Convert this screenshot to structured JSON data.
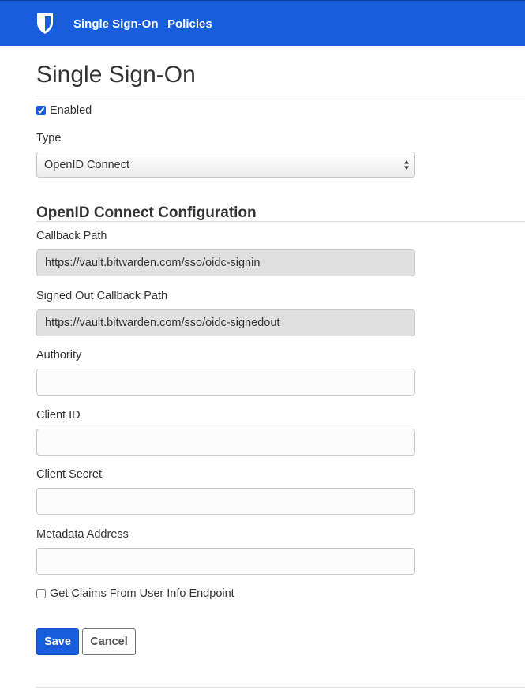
{
  "nav": {
    "logo_icon": "bitwarden-shield-icon",
    "items": [
      {
        "label": "Single Sign-On"
      },
      {
        "label": "Policies"
      }
    ]
  },
  "page": {
    "title": "Single Sign-On"
  },
  "enabled": {
    "label": "Enabled",
    "checked": true
  },
  "type": {
    "label": "Type",
    "selected": "OpenID Connect"
  },
  "oidc": {
    "section_title": "OpenID Connect Configuration",
    "callback_path": {
      "label": "Callback Path",
      "value": "https://vault.bitwarden.com/sso/oidc-signin"
    },
    "signed_out_callback_path": {
      "label": "Signed Out Callback Path",
      "value": "https://vault.bitwarden.com/sso/oidc-signedout"
    },
    "authority": {
      "label": "Authority",
      "value": ""
    },
    "client_id": {
      "label": "Client ID",
      "value": ""
    },
    "client_secret": {
      "label": "Client Secret",
      "value": ""
    },
    "metadata_address": {
      "label": "Metadata Address",
      "value": ""
    },
    "get_claims": {
      "label": "Get Claims From User Info Endpoint",
      "checked": false
    }
  },
  "actions": {
    "save_label": "Save",
    "cancel_label": "Cancel"
  },
  "colors": {
    "brand": "#175ddc",
    "readonly_field": "#e0e0e0"
  }
}
